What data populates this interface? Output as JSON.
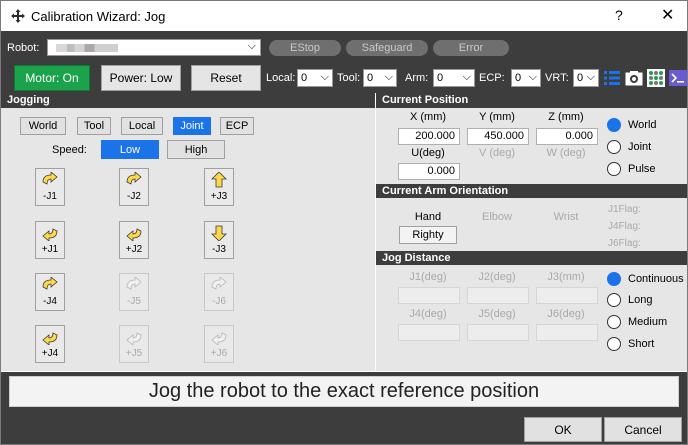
{
  "window": {
    "title": "Calibration Wizard: Jog",
    "help": "?",
    "close": "✕"
  },
  "toolbar": {
    "robot_label": "Robot:",
    "estop": "EStop",
    "safeguard": "Safeguard",
    "error": "Error",
    "motor": "Motor: On",
    "power": "Power: Low",
    "reset": "Reset",
    "local_label": "Local:",
    "local_value": "0",
    "tool_label": "Tool:",
    "tool_value": "0",
    "arm_label": "Arm:",
    "arm_value": "0",
    "ecp_label": "ECP:",
    "ecp_value": "0",
    "vrt_label": "VRT:",
    "vrt_value": "0"
  },
  "jogging": {
    "header": "Jogging",
    "modes": [
      "World",
      "Tool",
      "Local",
      "Joint",
      "ECP"
    ],
    "active_mode": "Joint",
    "speed_label": "Speed:",
    "speed_low": "Low",
    "speed_high": "High",
    "buttons": [
      "-J1",
      "-J2",
      "+J3",
      "+J1",
      "+J2",
      "-J3",
      "-J4",
      "-J5",
      "-J6",
      "+J4",
      "+J5",
      "+J6"
    ]
  },
  "current_position": {
    "header": "Current Position",
    "x_label": "X (mm)",
    "y_label": "Y (mm)",
    "z_label": "Z (mm)",
    "x": "200.000",
    "y": "450.000",
    "z": "0.000",
    "u_label": "U(deg)",
    "v_label": "V (deg)",
    "w_label": "W (deg)",
    "u": "0.000",
    "modes": [
      "World",
      "Joint",
      "Pulse"
    ],
    "selected": "World"
  },
  "orientation": {
    "header": "Current Arm Orientation",
    "hand": "Hand",
    "elbow": "Elbow",
    "wrist": "Wrist",
    "hand_value": "Righty",
    "j1flag": "J1Flag:",
    "j4flag": "J4Flag:",
    "j6flag": "J6Flag:"
  },
  "jog_distance": {
    "header": "Jog Distance",
    "j1": "J1(deg)",
    "j2": "J2(deg)",
    "j3": "J3(mm)",
    "j4": "J4(deg)",
    "j5": "J5(deg)",
    "j6": "J6(deg)",
    "modes": [
      "Continuous",
      "Long",
      "Medium",
      "Short"
    ],
    "selected": "Continuous"
  },
  "message": "Jog the robot to the exact reference position",
  "footer": {
    "ok": "OK",
    "cancel": "Cancel"
  },
  "colors": {
    "accent": "#1a73e8",
    "motor_on": "#1aa34a",
    "dark_bg": "#3d3d3d",
    "panel_bg": "#e6e6e6"
  }
}
